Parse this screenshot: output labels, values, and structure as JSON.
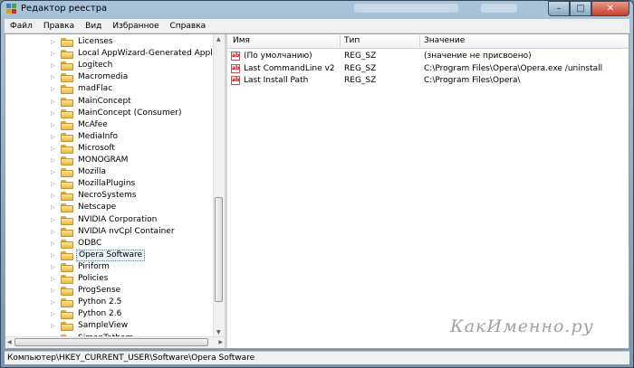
{
  "window": {
    "title": "Редактор реестра",
    "controls": {
      "minimize": "–",
      "maximize": "□",
      "close": "✕"
    }
  },
  "menu": [
    "Файл",
    "Правка",
    "Вид",
    "Избранное",
    "Справка"
  ],
  "tree": {
    "items": [
      {
        "label": "Licenses",
        "selected": false
      },
      {
        "label": "Local AppWizard-Generated Applicatio",
        "selected": false
      },
      {
        "label": "Logitech",
        "selected": false
      },
      {
        "label": "Macromedia",
        "selected": false
      },
      {
        "label": "madFlac",
        "selected": false
      },
      {
        "label": "MainConcept",
        "selected": false
      },
      {
        "label": "MainConcept (Consumer)",
        "selected": false
      },
      {
        "label": "McAfee",
        "selected": false
      },
      {
        "label": "MediaInfo",
        "selected": false
      },
      {
        "label": "Microsoft",
        "selected": false
      },
      {
        "label": "MONOGRAM",
        "selected": false
      },
      {
        "label": "Mozilla",
        "selected": false
      },
      {
        "label": "MozillaPlugins",
        "selected": false
      },
      {
        "label": "NecroSystems",
        "selected": false
      },
      {
        "label": "Netscape",
        "selected": false
      },
      {
        "label": "NVIDIA Corporation",
        "selected": false
      },
      {
        "label": "NVIDIA nvCpl Container",
        "selected": false
      },
      {
        "label": "ODBC",
        "selected": false
      },
      {
        "label": "Opera Software",
        "selected": true
      },
      {
        "label": "Piriform",
        "selected": false
      },
      {
        "label": "Policies",
        "selected": false
      },
      {
        "label": "ProgSense",
        "selected": false
      },
      {
        "label": "Python 2.5",
        "selected": false
      },
      {
        "label": "Python 2.6",
        "selected": false
      },
      {
        "label": "SampleView",
        "selected": false
      },
      {
        "label": "SimonTatham",
        "selected": false
      }
    ]
  },
  "values": {
    "headers": [
      "Имя",
      "Тип",
      "Значение"
    ],
    "rows": [
      {
        "icon": "string-value-icon",
        "name": "(По умолчанию)",
        "type": "REG_SZ",
        "data": "(значение не присвоено)"
      },
      {
        "icon": "string-value-icon",
        "name": "Last CommandLine v2",
        "type": "REG_SZ",
        "data": "C:\\Program Files\\Opera\\Opera.exe /uninstall"
      },
      {
        "icon": "string-value-icon",
        "name": "Last Install Path",
        "type": "REG_SZ",
        "data": "C:\\Program Files\\Opera\\"
      }
    ]
  },
  "status": {
    "path": "Компьютер\\HKEY_CURRENT_USER\\Software\\Opera Software"
  },
  "watermark": "КакИменно.ру",
  "colors": {
    "folder": "#e9b84a",
    "title_gradient": "#88a8c2",
    "selection_border": "#5a7ea8"
  }
}
